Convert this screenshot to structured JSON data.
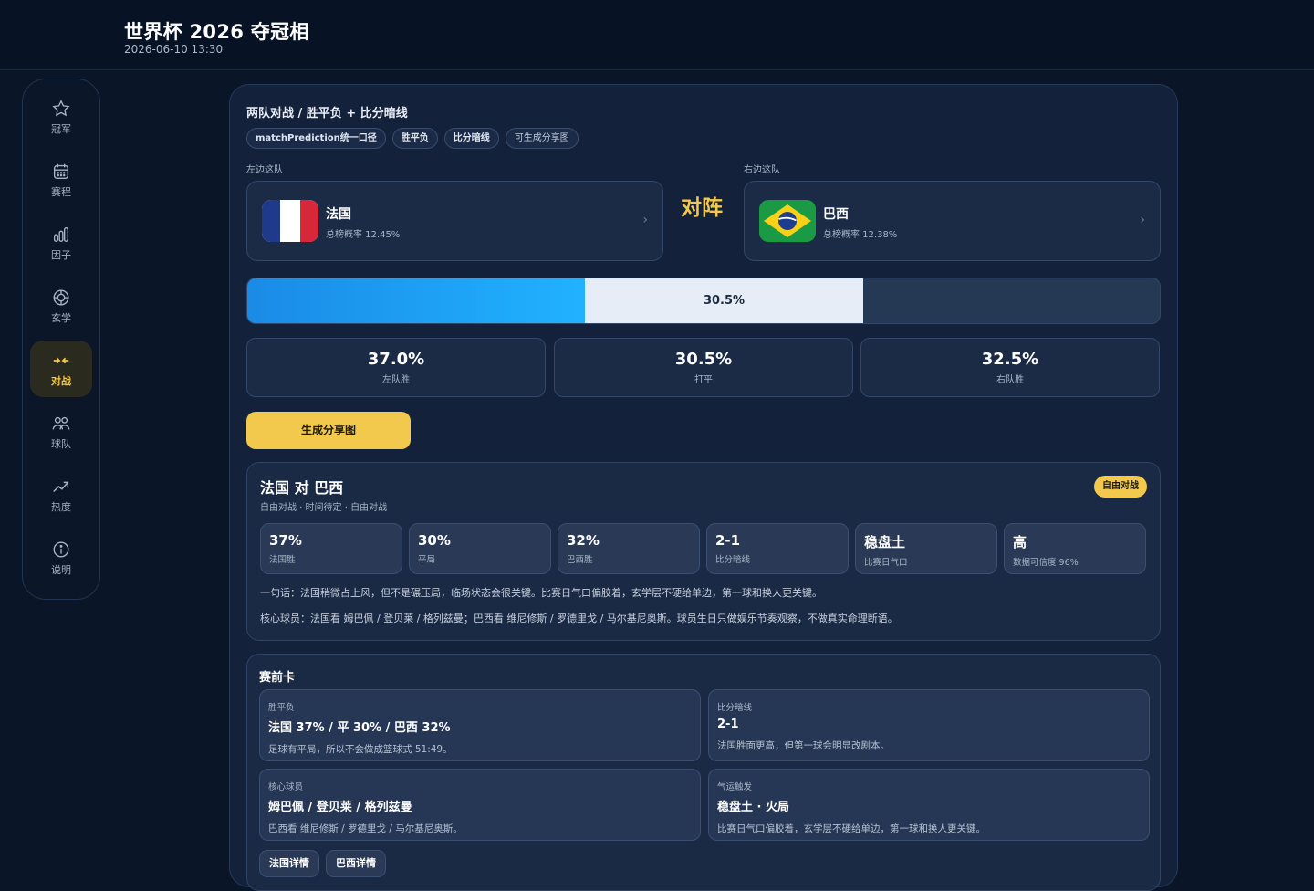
{
  "header": {
    "title": "世界杯 2026 夺冠相",
    "datetime": "2026-06-10 13:30"
  },
  "sidebar": {
    "items": [
      {
        "label": "冠军",
        "icon": "star-icon"
      },
      {
        "label": "赛程",
        "icon": "calendar-icon"
      },
      {
        "label": "因子",
        "icon": "bar-chart-icon"
      },
      {
        "label": "玄学",
        "icon": "compass-icon"
      },
      {
        "label": "对战",
        "icon": "versus-icon",
        "active": true
      },
      {
        "label": "球队",
        "icon": "team-icon"
      },
      {
        "label": "热度",
        "icon": "trend-icon"
      },
      {
        "label": "说明",
        "icon": "info-icon"
      }
    ]
  },
  "versus": {
    "section_title": "两队对战 / 胜平负 + 比分暗线",
    "chips": [
      "matchPrediction统一口径",
      "胜平负",
      "比分暗线",
      "可生成分享图"
    ],
    "left_label": "左边这队",
    "right_label": "右边这队",
    "vs_text": "对阵",
    "left_team": {
      "name": "法国",
      "prob": "总榜概率 12.45%",
      "flag": "france-flag"
    },
    "right_team": {
      "name": "巴西",
      "prob": "总榜概率 12.38%",
      "flag": "brazil-flag"
    },
    "bar": {
      "left_pct": 37.0,
      "draw_pct": 30.5,
      "right_pct": 32.5,
      "draw_label": "30.5%"
    },
    "stats": [
      {
        "value": "37.0%",
        "label": "左队胜"
      },
      {
        "value": "30.5%",
        "label": "打平"
      },
      {
        "value": "32.5%",
        "label": "右队胜"
      }
    ],
    "share_button": "生成分享图"
  },
  "match": {
    "title": "法国 对 巴西",
    "subtitle": "自由对战 · 时间待定 · 自由对战",
    "badge": "自由对战",
    "minis": [
      {
        "value": "37%",
        "label": "法国胜"
      },
      {
        "value": "30%",
        "label": "平局"
      },
      {
        "value": "32%",
        "label": "巴西胜"
      },
      {
        "value": "2-1",
        "label": "比分暗线"
      },
      {
        "value": "稳盘土",
        "label": "比赛日气口"
      },
      {
        "value": "高",
        "label": "数据可信度 96%"
      }
    ],
    "summary": "一句话：法国稍微占上风，但不是碾压局，临场状态会很关键。比赛日气口偏胶着，玄学层不硬给单边，第一球和换人更关键。",
    "players": "核心球员：法国看 姆巴佩 / 登贝莱 / 格列兹曼；巴西看 维尼修斯 / 罗德里戈 / 马尔基尼奥斯。球员生日只做娱乐节奏观察，不做真实命理断语。"
  },
  "precard": {
    "title": "赛前卡",
    "cards": [
      {
        "tag": "胜平负",
        "head": "法国 37% / 平 30% / 巴西 32%",
        "desc": "足球有平局，所以不会做成篮球式 51:49。"
      },
      {
        "tag": "比分暗线",
        "head": "2-1",
        "desc": "法国胜面更高，但第一球会明显改剧本。"
      },
      {
        "tag": "核心球员",
        "head": "姆巴佩 / 登贝莱 / 格列兹曼",
        "desc": "巴西看 维尼修斯 / 罗德里戈 / 马尔基尼奥斯。"
      },
      {
        "tag": "气运触发",
        "head": "稳盘土 · 火局",
        "desc": "比赛日气口偏胶着，玄学层不硬给单边，第一球和换人更关键。"
      }
    ],
    "detail_buttons": [
      "法国详情",
      "巴西详情"
    ]
  }
}
